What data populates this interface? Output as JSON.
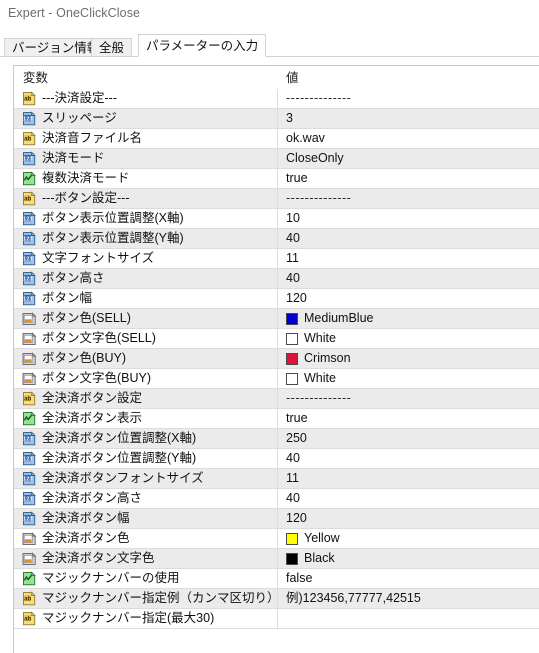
{
  "window": {
    "title": "Expert - OneClickClose"
  },
  "tabs": [
    {
      "label": "バージョン情報",
      "active": false
    },
    {
      "label": "全般",
      "active": false
    },
    {
      "label": "パラメーターの入力",
      "active": true
    }
  ],
  "grid": {
    "columns": [
      "変数",
      "値"
    ],
    "icon_colors": {
      "string": "#e8c95a",
      "int": "#4d86c8",
      "bool": "#5cb85c",
      "color": "#909090"
    },
    "rows": [
      {
        "icon": "string-param-icon",
        "name": "---決済設定---",
        "value": "--------------",
        "value_type": "dashes"
      },
      {
        "icon": "int-param-icon",
        "name": "スリッページ",
        "value": "3",
        "value_type": "text"
      },
      {
        "icon": "string-param-icon",
        "name": "決済音ファイル名",
        "value": "ok.wav",
        "value_type": "text"
      },
      {
        "icon": "int-param-icon",
        "name": "決済モード",
        "value": "CloseOnly",
        "value_type": "text"
      },
      {
        "icon": "bool-param-icon",
        "name": "複数決済モード",
        "value": "true",
        "value_type": "text"
      },
      {
        "icon": "string-param-icon",
        "name": "---ボタン設定---",
        "value": "--------------",
        "value_type": "dashes"
      },
      {
        "icon": "int-param-icon",
        "name": "ボタン表示位置調整(X軸)",
        "value": "10",
        "value_type": "text"
      },
      {
        "icon": "int-param-icon",
        "name": "ボタン表示位置調整(Y軸)",
        "value": "40",
        "value_type": "text"
      },
      {
        "icon": "int-param-icon",
        "name": "文字フォントサイズ",
        "value": "11",
        "value_type": "text"
      },
      {
        "icon": "int-param-icon",
        "name": "ボタン高さ",
        "value": "40",
        "value_type": "text"
      },
      {
        "icon": "int-param-icon",
        "name": "ボタン幅",
        "value": "120",
        "value_type": "text"
      },
      {
        "icon": "color-param-icon",
        "name": "ボタン色(SELL)",
        "value": "MediumBlue",
        "value_type": "color",
        "swatch": "#0000cd"
      },
      {
        "icon": "color-param-icon",
        "name": "ボタン文字色(SELL)",
        "value": "White",
        "value_type": "color",
        "swatch": "#ffffff"
      },
      {
        "icon": "color-param-icon",
        "name": "ボタン色(BUY)",
        "value": "Crimson",
        "value_type": "color",
        "swatch": "#dc143c"
      },
      {
        "icon": "color-param-icon",
        "name": "ボタン文字色(BUY)",
        "value": "White",
        "value_type": "color",
        "swatch": "#ffffff"
      },
      {
        "icon": "string-param-icon",
        "name": "全決済ボタン設定",
        "value": "--------------",
        "value_type": "dashes"
      },
      {
        "icon": "bool-param-icon",
        "name": "全決済ボタン表示",
        "value": "true",
        "value_type": "text"
      },
      {
        "icon": "int-param-icon",
        "name": "全決済ボタン位置調整(X軸)",
        "value": "250",
        "value_type": "text"
      },
      {
        "icon": "int-param-icon",
        "name": "全決済ボタン位置調整(Y軸)",
        "value": "40",
        "value_type": "text"
      },
      {
        "icon": "int-param-icon",
        "name": "全決済ボタンフォントサイズ",
        "value": "11",
        "value_type": "text"
      },
      {
        "icon": "int-param-icon",
        "name": "全決済ボタン高さ",
        "value": "40",
        "value_type": "text"
      },
      {
        "icon": "int-param-icon",
        "name": "全決済ボタン幅",
        "value": "120",
        "value_type": "text"
      },
      {
        "icon": "color-param-icon",
        "name": "全決済ボタン色",
        "value": "Yellow",
        "value_type": "color",
        "swatch": "#ffff00"
      },
      {
        "icon": "color-param-icon",
        "name": "全決済ボタン文字色",
        "value": "Black",
        "value_type": "color",
        "swatch": "#000000"
      },
      {
        "icon": "bool-param-icon",
        "name": "マジックナンバーの使用",
        "value": "false",
        "value_type": "text"
      },
      {
        "icon": "string-param-icon",
        "name": "マジックナンバー指定例（カンマ区切り）",
        "value": "例)123456,77777,42515",
        "value_type": "text"
      },
      {
        "icon": "string-param-icon",
        "name": "マジックナンバー指定(最大30)",
        "value": "",
        "value_type": "text"
      }
    ]
  }
}
